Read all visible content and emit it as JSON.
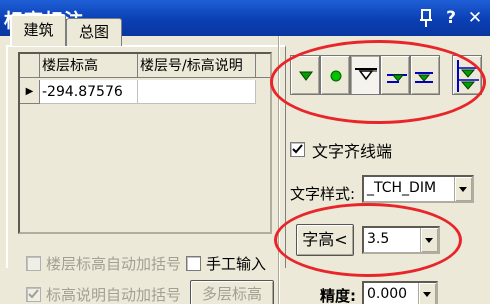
{
  "window": {
    "title": "标高标注",
    "pin_glyph": "🡄",
    "help_label": "?",
    "close_label": "✕"
  },
  "tabs": [
    {
      "label": "建筑",
      "active": true
    },
    {
      "label": "总图",
      "active": false
    }
  ],
  "grid": {
    "columns": [
      "楼层标高",
      "楼层号/标高说明"
    ],
    "rows": [
      {
        "marker": "▶",
        "elevation": "-294.87576",
        "note": ""
      }
    ]
  },
  "options": {
    "auto_bracket_floor": "楼层标高自动加括号",
    "manual_input": "手工输入",
    "auto_bracket_note": "标高说明自动加括号",
    "multi_floor_button": "多层标高"
  },
  "toolbar": {
    "icons": [
      "solid-triangle-icon",
      "circle-icon",
      "hollow-triangle-icon",
      "left-leader-triangle-icon",
      "right-leader-triangle-icon",
      "double-triangle-icon"
    ],
    "colors": {
      "green": "#00a000",
      "blue": "#0000c0"
    }
  },
  "settings": {
    "text_align_label": "文字齐线端",
    "text_style_label": "文字样式:",
    "text_style_value": "_TCH_DIM",
    "font_height_button": "字高<",
    "font_height_value": "3.5",
    "precision_label": "精度:",
    "precision_value": "0.000"
  },
  "annotations": {
    "ellipse_color": "#e8262a"
  }
}
